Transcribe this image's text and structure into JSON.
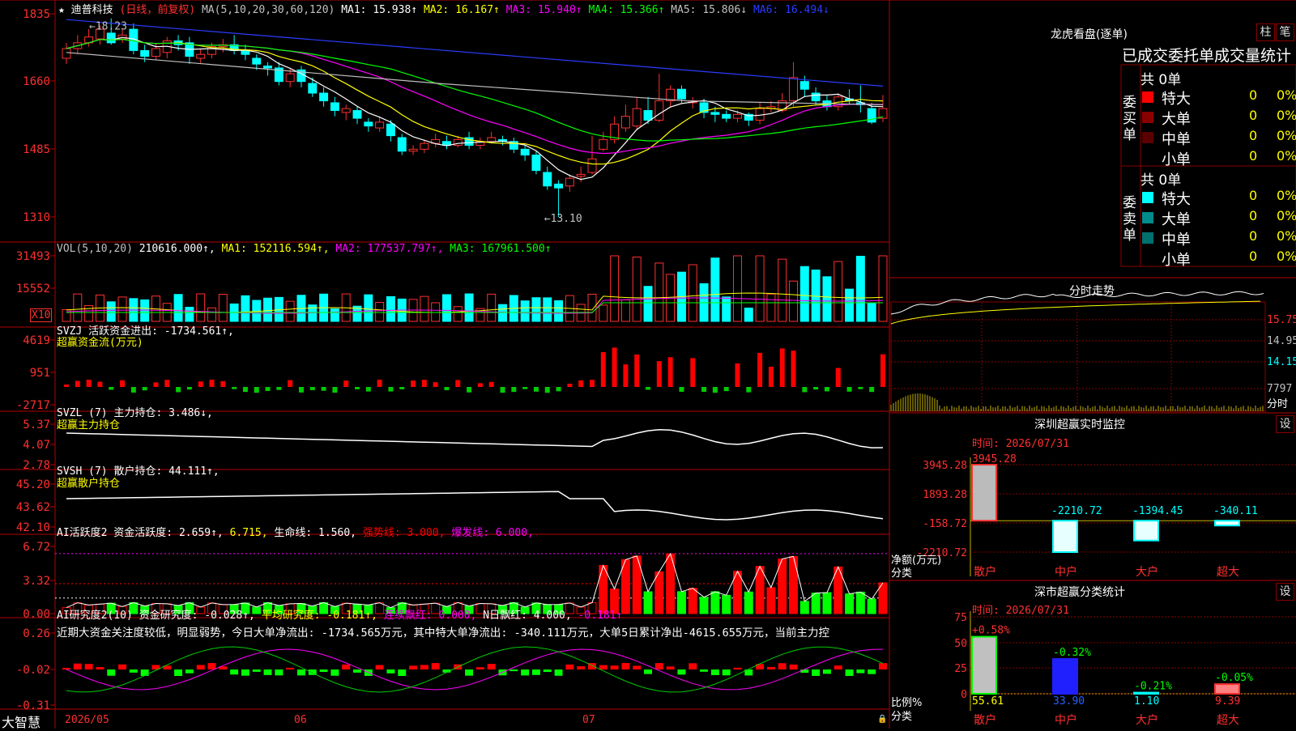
{
  "title_bar": {
    "star": "★",
    "stock_name": "迪普科技",
    "period": "(日线，前复权)",
    "ma_label": "MA(5,10,20,30,60,120)",
    "ma_items": [
      {
        "label": "MA1: 15.938↑",
        "color": "#ffffff"
      },
      {
        "label": "MA2: 16.167↑",
        "color": "#ffff00"
      },
      {
        "label": "MA3: 15.940↑",
        "color": "#ff00ff"
      },
      {
        "label": "MA4: 15.366↑",
        "color": "#00ff00"
      },
      {
        "label": "MA5: 15.806↓",
        "color": "#c0c0c0"
      },
      {
        "label": "MA6: 16.494↓",
        "color": "#2a3cff"
      }
    ]
  },
  "main_axis": [
    "1835",
    "1660",
    "1485",
    "1310"
  ],
  "main_annotations": {
    "high": "18.23",
    "low": "13.10"
  },
  "vol_panel": {
    "axis": [
      "31493",
      "15552"
    ],
    "unit_label": "X10",
    "legend": [
      {
        "label": "VOL(5,10,20)",
        "color": "#c0c0c0"
      },
      {
        "label": "210616.000↑,",
        "color": "#ffffff"
      },
      {
        "label": "MA1: 152116.594↑,",
        "color": "#ffff00"
      },
      {
        "label": "MA2: 177537.797↑,",
        "color": "#ff00ff"
      },
      {
        "label": "MA3: 167961.500↑",
        "color": "#00ff00"
      }
    ]
  },
  "svzj_panel": {
    "axis": [
      "4619",
      "951",
      "-2717"
    ],
    "line1": "SVZJ  活跃资金进出: -1734.561↑,",
    "line2": "超赢资金流(万元)"
  },
  "svzl_panel": {
    "axis": [
      "5.37",
      "4.07",
      "2.78"
    ],
    "line1": "SVZL (7) 主力持仓: 3.486↓,",
    "line2": "超赢主力持仓"
  },
  "svsh_panel": {
    "axis": [
      "45.20",
      "43.62",
      "42.10"
    ],
    "line1": "SVSH (7) 散户持仓: 44.111↑,",
    "line2": "超赢散户持仓"
  },
  "ai_active_panel": {
    "axis": [
      "6.72",
      "3.32",
      "0.00"
    ],
    "legend": [
      {
        "label": "AI活跃度2 资金活跃度: 2.659↑,",
        "color": "#ffffff"
      },
      {
        "label": "6.715,",
        "color": "#ffff00"
      },
      {
        "label": "生命线: 1.560,",
        "color": "#ffffff"
      },
      {
        "label": "强势线: 3.000,",
        "color": "#ff0000"
      },
      {
        "label": "爆发线: 6.000,",
        "color": "#ff00ff"
      }
    ]
  },
  "ai_research_panel": {
    "axis": [
      "0.26",
      "-0.02",
      "-0.31"
    ],
    "legend": [
      {
        "label": "AI研究度2(10) 资金研究度: -0.028↑,",
        "color": "#ffffff"
      },
      {
        "label": "平均研究度: -0.181↑,",
        "color": "#ffff00"
      },
      {
        "label": "连续飘红: 0.000,",
        "color": "#ff00ff"
      },
      {
        "label": "N日飘红: 4.000,",
        "color": "#ffffff"
      },
      {
        "label": "-0.181↑",
        "color": "#ff00ff"
      }
    ],
    "commentary": "近期大资金关注度较低，明显弱势，今日大单净流出: -1734.565万元，其中特大单净流出: -340.111万元，大单5日累计净出-4615.655万元，当前主力控"
  },
  "bottom_bar": {
    "logo": "大智慧",
    "date1": "2026/05",
    "date2": "06",
    "date3": "07"
  },
  "longhu": {
    "title": "龙虎看盘(逐单)",
    "btn_zhu": "柱",
    "btn_bi": "笔",
    "stats_title": "已成交委托单成交量统计",
    "buy_side": {
      "label": "委买单",
      "total": "共 0单",
      "rows": [
        {
          "name": "特大",
          "count": "0",
          "pct": "0%",
          "color": "#ff0000"
        },
        {
          "name": "大单",
          "count": "0",
          "pct": "0%",
          "color": "#8a0000"
        },
        {
          "name": "中单",
          "count": "0",
          "pct": "0%",
          "color": "#5a0000"
        },
        {
          "name": "小单",
          "count": "0",
          "pct": "0%",
          "color": ""
        }
      ]
    },
    "sell_side": {
      "label": "委卖单",
      "total": "共 0单",
      "rows": [
        {
          "name": "特大",
          "count": "0",
          "pct": "0%",
          "color": "#00ffff"
        },
        {
          "name": "大单",
          "count": "0",
          "pct": "0%",
          "color": "#008c8c"
        },
        {
          "name": "中单",
          "count": "0",
          "pct": "0%",
          "color": "#007070"
        },
        {
          "name": "小单",
          "count": "0",
          "pct": "0%",
          "color": ""
        }
      ]
    }
  },
  "intraday": {
    "title": "分时走势",
    "axis": [
      "15.75",
      "14.95",
      "14.15",
      "7797"
    ],
    "unit": "分时"
  },
  "sz_monitor": {
    "title": "深圳超赢实时监控",
    "btn": "设",
    "time_label": "时间: 2026/07/31",
    "axis": [
      "3945.28",
      "1893.28",
      "-158.72",
      "-2210.72"
    ],
    "ylabel1": "净额(万元)",
    "ylabel2": "分类",
    "categories": [
      "散户",
      "中户",
      "大户",
      "超大"
    ],
    "values": [
      3945.28,
      -2210.72,
      -1394.45,
      -340.11
    ],
    "value_labels": [
      "3945.28",
      "-2210.72",
      "-1394.45",
      "-340.11"
    ]
  },
  "sz_class": {
    "title": "深市超赢分类统计",
    "btn": "设",
    "time_label": "时间: 2026/07/31",
    "axis": [
      "75",
      "50",
      "25",
      "0"
    ],
    "ylabel1": "比例%",
    "ylabel2": "分类",
    "categories": [
      "散户",
      "中户",
      "大户",
      "超大"
    ],
    "values": [
      55.61,
      33.9,
      1.1,
      9.39
    ],
    "value_labels": [
      "55.61",
      "33.90",
      "1.10",
      "9.39"
    ],
    "change_labels": [
      "+0.58%",
      "-0.32%",
      "-0.21%",
      "-0.05%"
    ]
  },
  "chart_data": {
    "type": "candlestick",
    "dates": [
      "2026/05",
      "06",
      "07"
    ],
    "ylim": [
      13.1,
      18.35
    ],
    "annotations": {
      "high": 18.23,
      "low": 13.1
    },
    "moving_averages": [
      {
        "name": "MA1",
        "value": 15.938
      },
      {
        "name": "MA2",
        "value": 16.167
      },
      {
        "name": "MA3",
        "value": 15.94
      },
      {
        "name": "MA4",
        "value": 15.366
      },
      {
        "name": "MA5",
        "value": 15.806
      },
      {
        "name": "MA6",
        "value": 16.494
      }
    ],
    "candles": [
      [
        17.2,
        17.45,
        17.6,
        17.05
      ],
      [
        17.45,
        17.6,
        17.8,
        17.3
      ],
      [
        17.6,
        17.75,
        17.95,
        17.5
      ],
      [
        17.7,
        17.95,
        18.05,
        17.55
      ],
      [
        17.85,
        17.6,
        18.23,
        17.55
      ],
      [
        17.7,
        17.8,
        17.95,
        17.6
      ],
      [
        17.95,
        17.4,
        18.1,
        17.3
      ],
      [
        17.4,
        17.25,
        17.55,
        17.1
      ],
      [
        17.25,
        17.45,
        17.6,
        17.15
      ],
      [
        17.35,
        17.65,
        17.75,
        17.2
      ],
      [
        17.65,
        17.55,
        17.8,
        17.4
      ],
      [
        17.6,
        17.25,
        17.75,
        17.05
      ],
      [
        17.2,
        17.3,
        17.45,
        17.05
      ],
      [
        17.3,
        17.5,
        17.6,
        17.2
      ],
      [
        17.5,
        17.55,
        17.7,
        17.35
      ],
      [
        17.55,
        17.4,
        17.8,
        17.3
      ],
      [
        17.4,
        17.3,
        17.55,
        17.15
      ],
      [
        17.2,
        17.05,
        17.3,
        16.9
      ],
      [
        17.0,
        16.95,
        17.1,
        16.75
      ],
      [
        16.95,
        16.6,
        17.1,
        16.5
      ],
      [
        16.6,
        16.8,
        16.95,
        16.45
      ],
      [
        16.9,
        16.6,
        17.0,
        16.45
      ],
      [
        16.55,
        16.3,
        16.7,
        16.2
      ],
      [
        16.3,
        16.1,
        16.45,
        15.95
      ],
      [
        16.05,
        15.85,
        16.2,
        15.7
      ],
      [
        15.8,
        15.9,
        16.0,
        15.6
      ],
      [
        15.85,
        15.65,
        15.95,
        15.5
      ],
      [
        15.55,
        15.45,
        15.65,
        15.3
      ],
      [
        15.4,
        15.55,
        15.7,
        15.3
      ],
      [
        15.5,
        15.2,
        15.6,
        15.05
      ],
      [
        15.15,
        14.8,
        15.25,
        14.7
      ],
      [
        14.8,
        14.85,
        14.95,
        14.7
      ],
      [
        14.85,
        15.0,
        15.1,
        14.75
      ],
      [
        15.0,
        15.1,
        15.25,
        14.9
      ],
      [
        15.05,
        14.95,
        15.2,
        14.85
      ],
      [
        14.95,
        15.1,
        15.2,
        14.9
      ],
      [
        15.15,
        14.95,
        15.3,
        14.85
      ],
      [
        14.95,
        15.05,
        15.15,
        14.85
      ],
      [
        15.05,
        15.15,
        15.3,
        15.0
      ],
      [
        15.1,
        15.05,
        15.2,
        14.95
      ],
      [
        15.05,
        14.85,
        15.15,
        14.75
      ],
      [
        14.85,
        14.7,
        14.95,
        14.55
      ],
      [
        14.7,
        14.3,
        14.8,
        14.2
      ],
      [
        14.25,
        13.9,
        14.4,
        13.8
      ],
      [
        13.95,
        13.85,
        14.05,
        13.1
      ],
      [
        13.9,
        14.1,
        14.2,
        13.75
      ],
      [
        14.15,
        14.2,
        14.4,
        14.0
      ],
      [
        14.25,
        14.6,
        15.2,
        14.2
      ],
      [
        14.85,
        15.1,
        15.3,
        14.8
      ],
      [
        15.1,
        15.5,
        15.7,
        15.0
      ],
      [
        15.4,
        15.7,
        16.0,
        15.3
      ],
      [
        15.45,
        15.9,
        16.2,
        15.35
      ],
      [
        15.85,
        15.6,
        16.2,
        15.5
      ],
      [
        15.6,
        16.1,
        16.8,
        15.55
      ],
      [
        16.1,
        16.4,
        16.5,
        15.95
      ],
      [
        16.4,
        16.15,
        16.5,
        16.05
      ],
      [
        16.05,
        16.1,
        16.2,
        15.9
      ],
      [
        16.05,
        15.8,
        16.15,
        15.65
      ],
      [
        15.8,
        15.75,
        15.95,
        15.55
      ],
      [
        15.75,
        15.65,
        15.85,
        15.55
      ],
      [
        15.65,
        15.75,
        15.85,
        15.55
      ],
      [
        15.75,
        15.6,
        15.8,
        15.45
      ],
      [
        15.6,
        15.9,
        16.05,
        15.5
      ],
      [
        15.9,
        15.95,
        16.1,
        15.8
      ],
      [
        15.85,
        16.1,
        16.3,
        15.8
      ],
      [
        16.1,
        16.7,
        17.1,
        15.95
      ],
      [
        16.6,
        16.4,
        16.75,
        16.2
      ],
      [
        16.3,
        16.1,
        16.45,
        16.0
      ],
      [
        16.1,
        15.95,
        16.25,
        15.85
      ],
      [
        15.95,
        16.2,
        16.3,
        15.85
      ],
      [
        16.15,
        16.1,
        16.4,
        16.0
      ],
      [
        16.05,
        16.0,
        16.5,
        15.8
      ],
      [
        15.9,
        15.55,
        16.05,
        15.5
      ],
      [
        15.65,
        15.9,
        16.25,
        15.55
      ]
    ],
    "volume_axis": [
      31493,
      15552
    ],
    "svzj": {
      "current": -1734.561,
      "axis": [
        4619,
        951,
        -2717
      ]
    },
    "svzl": {
      "current": 3.486,
      "axis": [
        5.37,
        4.07,
        2.78
      ]
    },
    "svsh": {
      "current": 44.111,
      "axis": [
        45.2,
        43.62,
        42.1
      ]
    },
    "ai_active": {
      "current": 2.659,
      "lines": {
        "life": 1.56,
        "strong": 3.0,
        "burst": 6.0
      },
      "axis": [
        6.72,
        3.32,
        0.0
      ]
    },
    "ai_research": {
      "current": -0.028,
      "average": -0.181,
      "axis": [
        0.26,
        -0.02,
        -0.31
      ]
    }
  }
}
